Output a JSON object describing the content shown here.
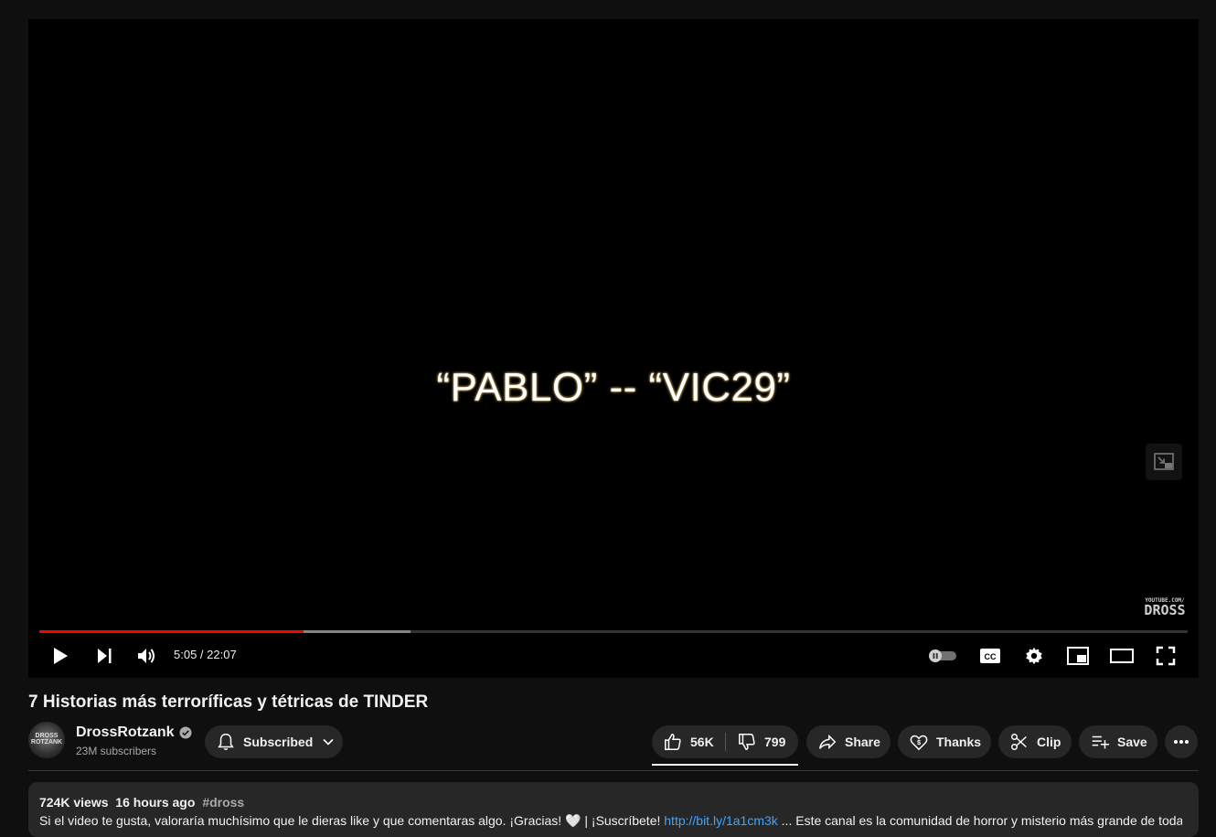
{
  "player": {
    "caption": "“PABLO” -- “VIC29”",
    "watermark_top": "YOUTUBE.COM/",
    "watermark_main": "DROSS",
    "progress_played_fraction": 0.23,
    "progress_buffered_fraction": 0.323,
    "current_time": "5:05",
    "duration": "22:07",
    "time_display": "5:05 / 22:07"
  },
  "video": {
    "title": "7 Historias más terroríficas y tétricas de TINDER"
  },
  "channel": {
    "name": "DrossRotzank",
    "subscribers": "23M subscribers",
    "avatar_text": "DROSS ROTZANK",
    "subscribe_label": "Subscribed"
  },
  "actions": {
    "likes": "56K",
    "dislikes": "799",
    "share": "Share",
    "thanks": "Thanks",
    "clip": "Clip",
    "save": "Save"
  },
  "description": {
    "views": "724K views",
    "age": "16 hours ago",
    "hashtag": "#dross",
    "text_before_link": "Si el video te gusta, valoraría muchísimo que le dieras like y que comentaras algo. ¡Gracias! 🤍 | ¡Suscríbete! ",
    "link": "http://bit.ly/1a1cm3k",
    "text_after_link": " ... Este canal es la comunidad de horror y misterio más grande de toda"
  },
  "icons": {
    "play": "play-icon",
    "next": "next-icon",
    "volume": "volume-icon",
    "autoplay": "autoplay-toggle-icon",
    "captions": "cc-icon",
    "settings": "gear-icon",
    "miniplayer": "miniplayer-icon",
    "theater": "theater-icon",
    "fullscreen": "fullscreen-icon"
  },
  "colors": {
    "progress": "#ff0000",
    "link": "#3ea6ff",
    "background": "#0f0f0f",
    "pill": "#272727"
  }
}
